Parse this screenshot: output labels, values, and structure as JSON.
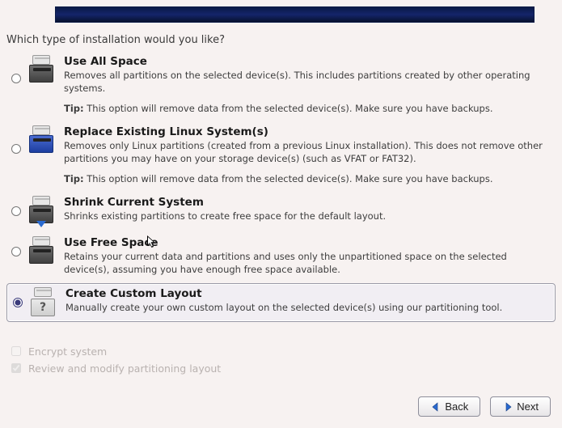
{
  "question": "Which type of installation would you like?",
  "options": [
    {
      "id": "use-all-space",
      "title": "Use All Space",
      "desc": "Removes all partitions on the selected device(s).  This includes partitions created by other operating systems.",
      "tip_label": "Tip:",
      "tip": "This option will remove data from the selected device(s).  Make sure you have backups.",
      "icon": "disk-dark",
      "selected": false
    },
    {
      "id": "replace-linux",
      "title": "Replace Existing Linux System(s)",
      "desc": "Removes only Linux partitions (created from a previous Linux installation).  This does not remove other partitions you may have on your storage device(s) (such as VFAT or FAT32).",
      "tip_label": "Tip:",
      "tip": "This option will remove data from the selected device(s).  Make sure you have backups.",
      "icon": "disk-blue",
      "selected": false
    },
    {
      "id": "shrink-current",
      "title": "Shrink Current System",
      "desc": "Shrinks existing partitions to create free space for the default layout.",
      "tip_label": "",
      "tip": "",
      "icon": "disk-arrow",
      "selected": false
    },
    {
      "id": "use-free-space",
      "title": "Use Free Space",
      "desc": "Retains your current data and partitions and uses only the unpartitioned space on the selected device(s), assuming you have enough free space available.",
      "tip_label": "",
      "tip": "",
      "icon": "disk-dark",
      "selected": false
    },
    {
      "id": "create-custom",
      "title": "Create Custom Layout",
      "desc": "Manually create your own custom layout on the selected device(s) using our partitioning tool.",
      "tip_label": "",
      "tip": "",
      "icon": "question",
      "selected": true
    }
  ],
  "checkboxes": {
    "encrypt": {
      "label": "Encrypt system",
      "checked": false,
      "enabled": false
    },
    "review": {
      "label": "Review and modify partitioning layout",
      "checked": true,
      "enabled": false
    }
  },
  "buttons": {
    "back": "Back",
    "next": "Next"
  },
  "colors": {
    "arrow_back": "#2a6ad0",
    "arrow_next": "#2a6ad0"
  }
}
